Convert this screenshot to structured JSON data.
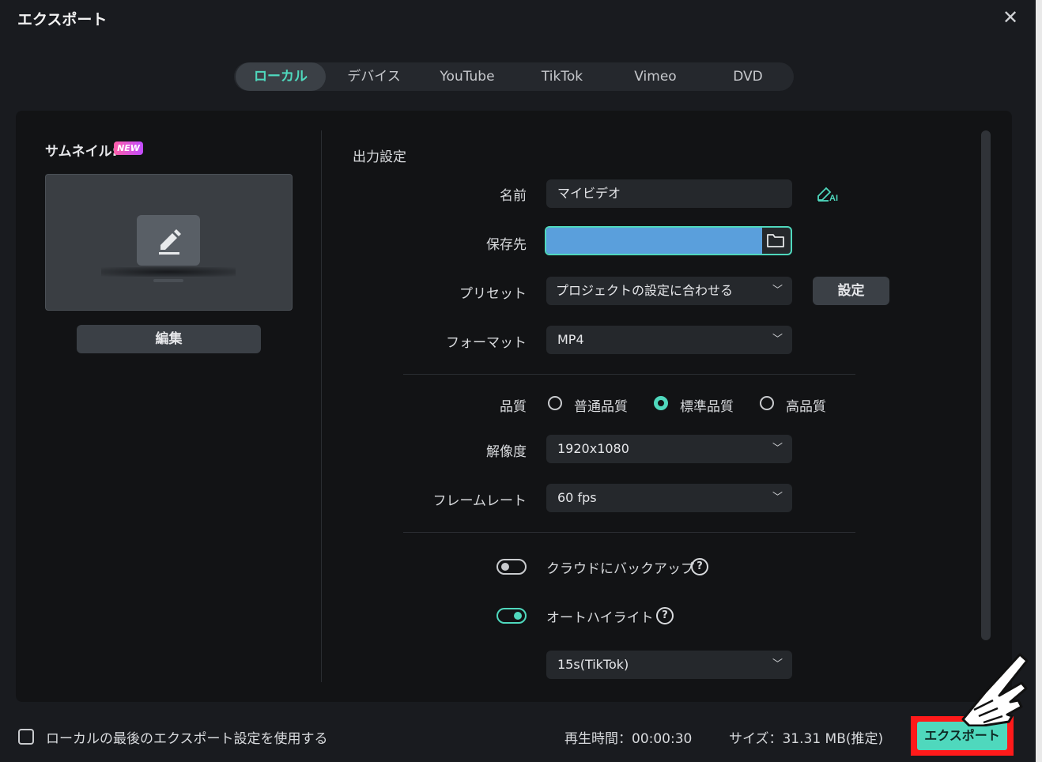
{
  "window": {
    "title": "エクスポート"
  },
  "tabs": [
    {
      "label": "ローカル",
      "active": true
    },
    {
      "label": "デバイス"
    },
    {
      "label": "YouTube"
    },
    {
      "label": "TikTok"
    },
    {
      "label": "Vimeo"
    },
    {
      "label": "DVD"
    }
  ],
  "thumbnail": {
    "label": "サムネイル:",
    "badge": "NEW",
    "edit_label": "編集"
  },
  "output": {
    "section_title": "出力設定",
    "name_label": "名前",
    "name_value": "マイビデオ",
    "ai_badge": "AI",
    "save_label": "保存先",
    "preset_label": "プリセット",
    "preset_value": "プロジェクトの設定に合わせる",
    "settings_button": "設定",
    "format_label": "フォーマット",
    "format_value": "MP4",
    "quality_label": "品質",
    "quality_options": [
      {
        "label": "普通品質",
        "selected": false
      },
      {
        "label": "標準品質",
        "selected": true
      },
      {
        "label": "高品質",
        "selected": false
      }
    ],
    "resolution_label": "解像度",
    "resolution_value": "1920x1080",
    "framerate_label": "フレームレート",
    "framerate_value": "60 fps",
    "cloud_backup_label": "クラウドにバックアップ",
    "cloud_backup_on": false,
    "auto_highlight_label": "オートハイライト",
    "auto_highlight_on": true,
    "highlight_value": "15s(TikTok)"
  },
  "footer": {
    "use_last_label": "ローカルの最後のエクスポート設定を使用する",
    "duration": "再生時間：00:00:30",
    "size": "サイズ：31.31 MB(推定)",
    "export_button": "エクスポート"
  },
  "colors": {
    "accent": "#4fd8bd",
    "highlight_frame": "#ff1a1a",
    "path_fill": "#5a9fdc"
  }
}
